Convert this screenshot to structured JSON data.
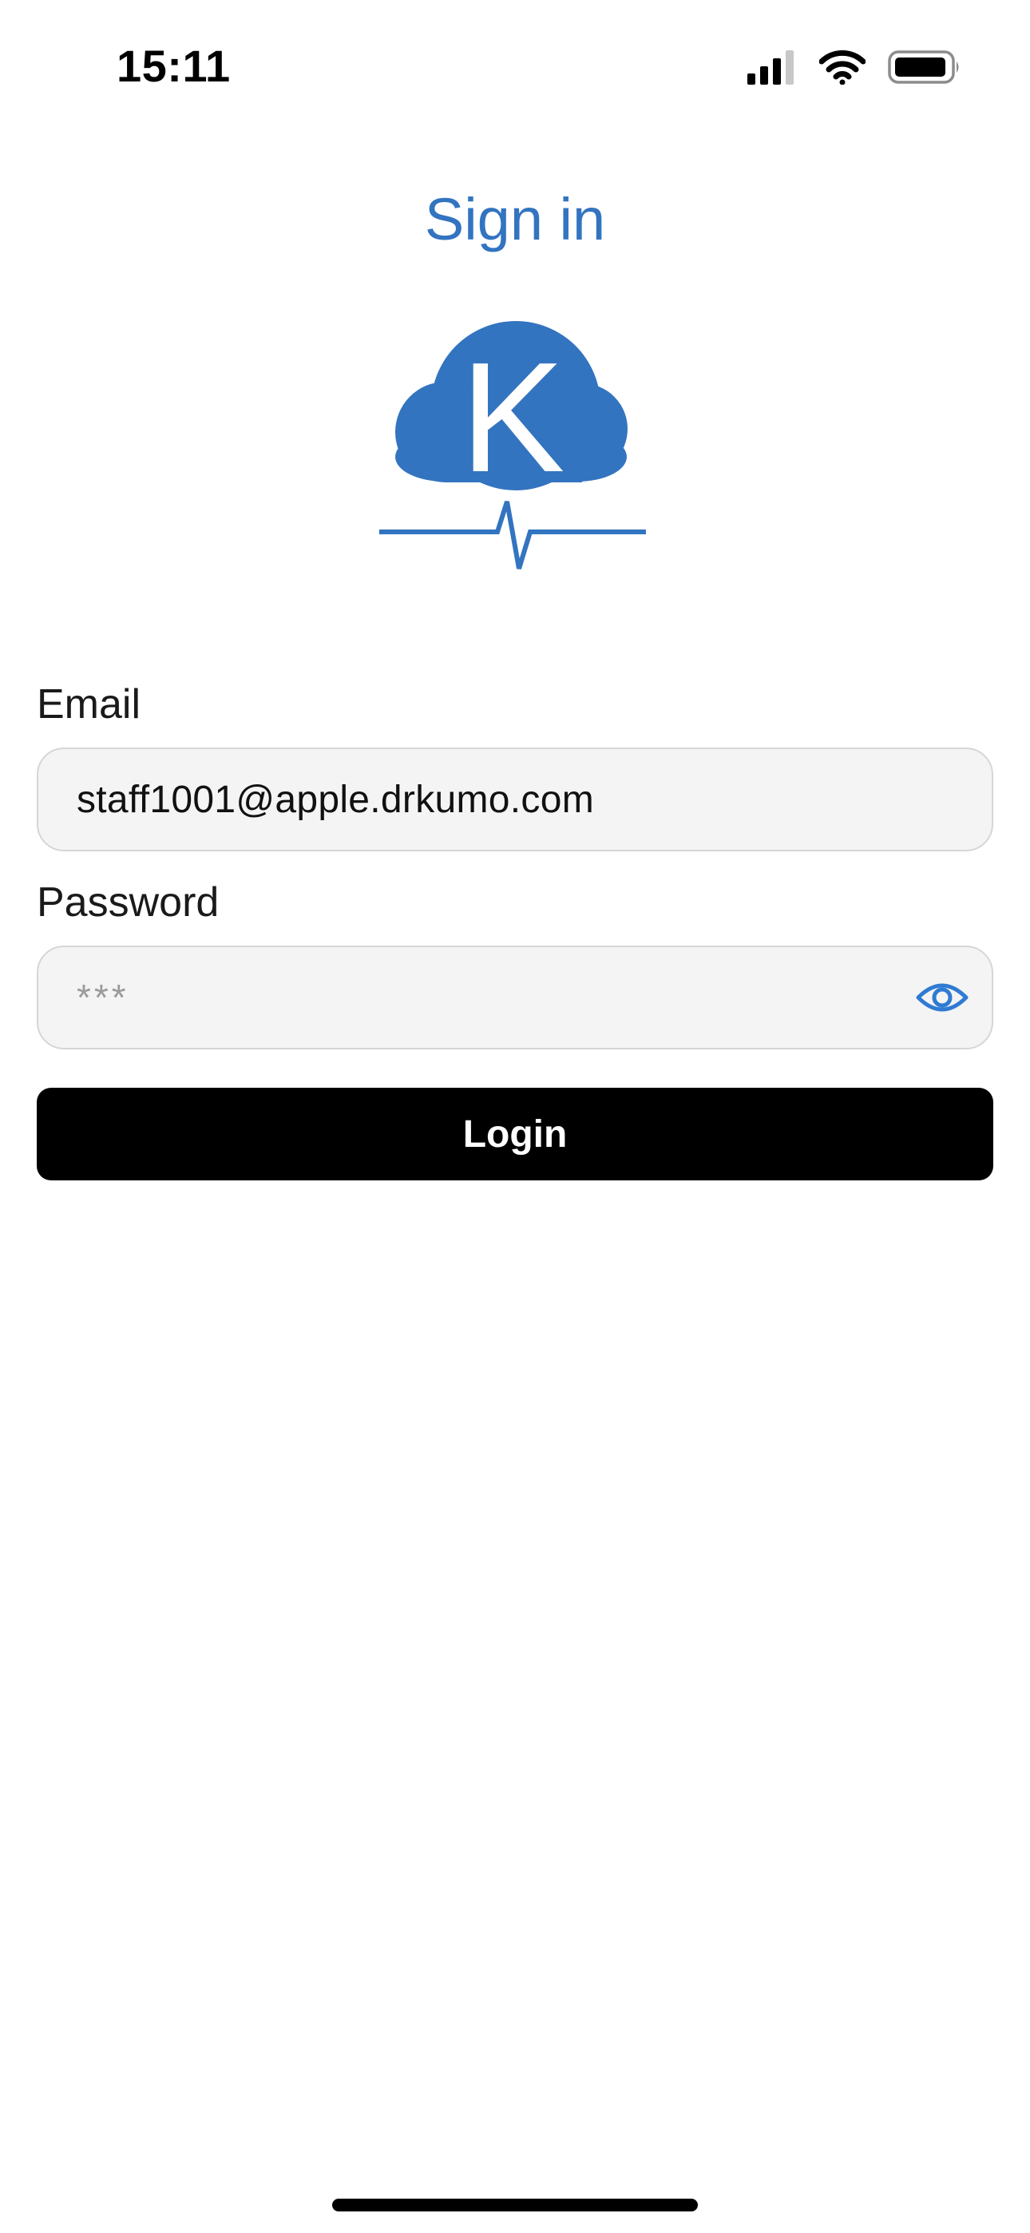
{
  "status_bar": {
    "time": "15:11",
    "icons": [
      "cellular-signal-icon",
      "wifi-icon",
      "battery-icon"
    ]
  },
  "page": {
    "title": "Sign in",
    "accent_color": "#3374c0"
  },
  "logo": {
    "letter": "K",
    "icon": "cloud-heartbeat-logo"
  },
  "form": {
    "email_label": "Email",
    "email_value": "staff1001@apple.drkumo.com",
    "password_label": "Password",
    "password_placeholder": "***",
    "password_toggle_icon": "eye-icon",
    "login_label": "Login"
  }
}
